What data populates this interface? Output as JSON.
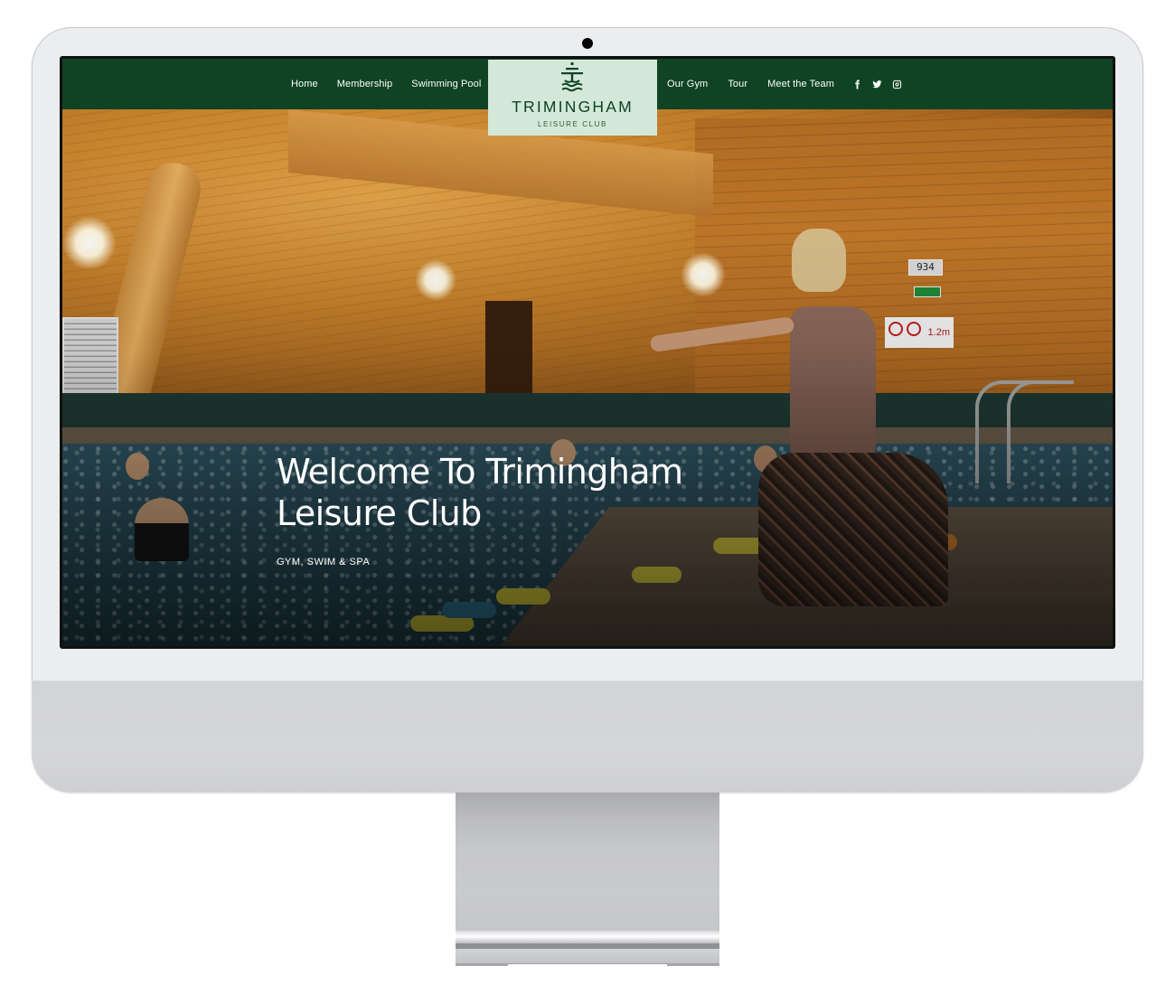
{
  "nav": {
    "left_links": [
      {
        "label": "Home"
      },
      {
        "label": "Membership"
      },
      {
        "label": "Swimming Pool"
      }
    ],
    "right_links": [
      {
        "label": "Our Gym"
      },
      {
        "label": "Tour"
      },
      {
        "label": "Meet the Team"
      }
    ],
    "social": [
      {
        "icon": "facebook-icon"
      },
      {
        "icon": "twitter-icon"
      },
      {
        "icon": "instagram-icon"
      }
    ]
  },
  "logo": {
    "name": "TRIMINGHAM",
    "subtitle": "LEISURE CLUB"
  },
  "hero": {
    "title": "Welcome To Trimingham Leisure Club",
    "subtitle": "GYM, SWIM & SPA",
    "photo": {
      "clock_readout": "934",
      "depth_marker": "1.2m"
    }
  },
  "colors": {
    "nav_green": "#0f4324",
    "logo_bg": "#d3e8d8",
    "monitor_bezel": "#ecedef"
  }
}
